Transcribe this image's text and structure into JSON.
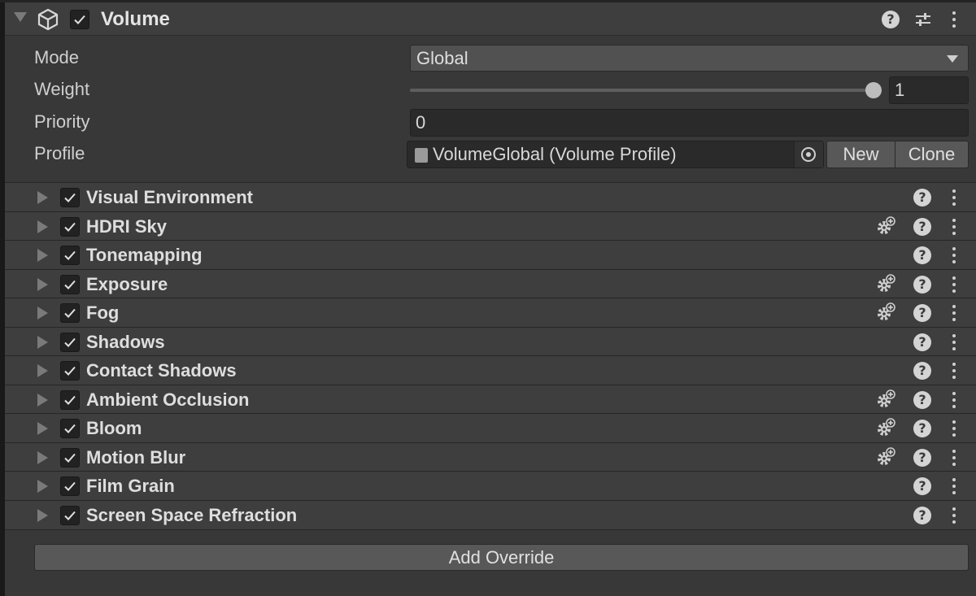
{
  "component": {
    "title": "Volume",
    "enabled": true,
    "icons": [
      "cube-icon",
      "help-icon",
      "preset-icon",
      "menu-icon"
    ]
  },
  "properties": {
    "mode": {
      "label": "Mode",
      "value": "Global"
    },
    "weight": {
      "label": "Weight",
      "value": "1",
      "slider_fraction": 1.0
    },
    "priority": {
      "label": "Priority",
      "value": "0"
    },
    "profile": {
      "label": "Profile",
      "value": "VolumeGlobal (Volume Profile)",
      "new_label": "New",
      "clone_label": "Clone"
    }
  },
  "overrides": [
    {
      "label": "Visual Environment",
      "enabled": true,
      "has_gear": false
    },
    {
      "label": "HDRI Sky",
      "enabled": true,
      "has_gear": true
    },
    {
      "label": "Tonemapping",
      "enabled": true,
      "has_gear": false
    },
    {
      "label": "Exposure",
      "enabled": true,
      "has_gear": true
    },
    {
      "label": "Fog",
      "enabled": true,
      "has_gear": true
    },
    {
      "label": "Shadows",
      "enabled": true,
      "has_gear": false
    },
    {
      "label": "Contact Shadows",
      "enabled": true,
      "has_gear": false
    },
    {
      "label": "Ambient Occlusion",
      "enabled": true,
      "has_gear": true
    },
    {
      "label": "Bloom",
      "enabled": true,
      "has_gear": true
    },
    {
      "label": "Motion Blur",
      "enabled": true,
      "has_gear": true
    },
    {
      "label": "Film Grain",
      "enabled": true,
      "has_gear": false
    },
    {
      "label": "Screen Space Refraction",
      "enabled": true,
      "has_gear": false
    }
  ],
  "help_glyph": "?",
  "add_override_label": "Add Override",
  "colors": {
    "panel": "#383838",
    "header": "#3e3e3e",
    "field": "#2a2a2a",
    "button": "#585858"
  }
}
